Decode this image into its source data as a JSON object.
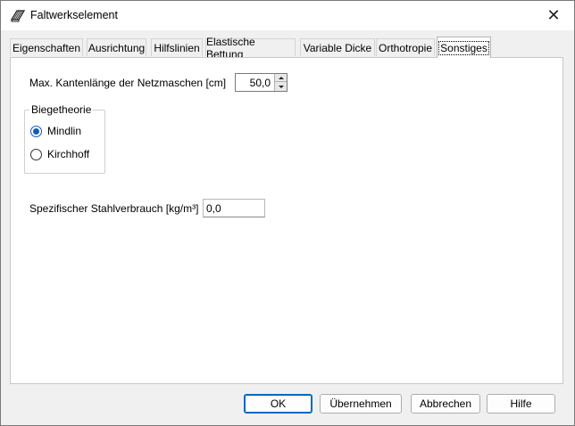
{
  "window": {
    "title": "Faltwerkselement",
    "close_label": "✕"
  },
  "tabs": [
    {
      "label": "Eigenschaften"
    },
    {
      "label": "Ausrichtung"
    },
    {
      "label": "Hilfslinien"
    },
    {
      "label": "Elastische Bettung"
    },
    {
      "label": "Variable Dicke"
    },
    {
      "label": "Orthotropie"
    },
    {
      "label": "Sonstiges",
      "active": true
    }
  ],
  "panel": {
    "max_edge_label": "Max. Kantenlänge der Netzmaschen [cm]",
    "max_edge_value": "50,0",
    "bending_theory": {
      "title": "Biegetheorie",
      "options": [
        {
          "label": "Mindlin",
          "checked": true
        },
        {
          "label": "Kirchhoff",
          "checked": false
        }
      ]
    },
    "steel_label": "Spezifischer Stahlverbrauch [kg/m³]",
    "steel_value": "0,0"
  },
  "buttons": {
    "ok": "OK",
    "apply": "Übernehmen",
    "cancel": "Abbrechen",
    "help": "Hilfe"
  },
  "colors": {
    "accent": "#0067c0",
    "radio_checked": "#0f5cc0"
  }
}
